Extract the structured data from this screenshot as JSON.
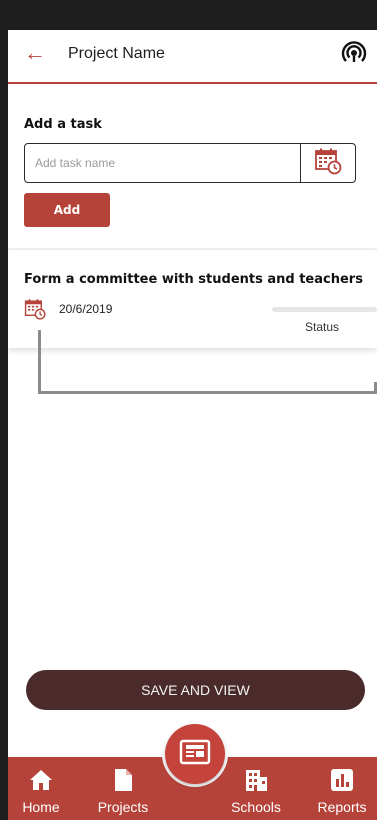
{
  "app_bar": {
    "back_icon": "arrow-left-icon",
    "title": "Project Name",
    "broadcast_icon": "broadcast-icon"
  },
  "add_task": {
    "heading": "Add a task",
    "input_value": "",
    "input_placeholder": "Add task name",
    "calendar_icon": "calendar-clock-icon",
    "add_label": "Add"
  },
  "task": {
    "name": "Form a committee with students and teachers",
    "date": "20/6/2019",
    "status_label": "Status",
    "status_progress": 0
  },
  "save_button": {
    "label": "SAVE AND VIEW"
  },
  "bottom_nav": {
    "items": [
      {
        "label": "Home",
        "icon": "home-icon"
      },
      {
        "label": "Projects",
        "icon": "file-icon"
      },
      {
        "label": "Schools",
        "icon": "building-icon"
      },
      {
        "label": "Reports",
        "icon": "bar-chart-icon"
      }
    ],
    "fab_icon": "newspaper-icon"
  },
  "colors": {
    "accent": "#b6433a",
    "save_button": "#4a2a2a",
    "background": "#ffffff",
    "outer_frame": "#1e1e1e"
  }
}
